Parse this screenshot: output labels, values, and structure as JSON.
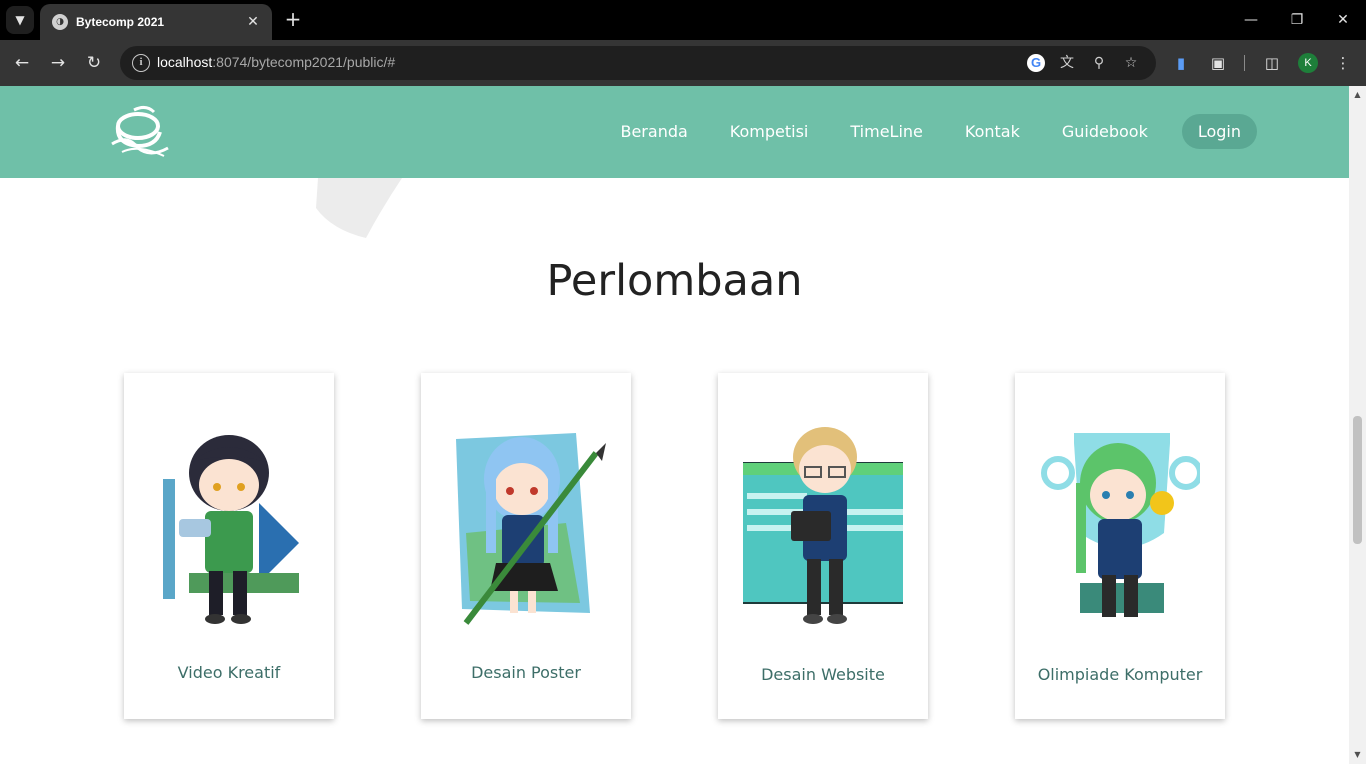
{
  "browser": {
    "tab_title": "Bytecomp 2021",
    "url_host": "localhost",
    "url_rest": ":8074/bytecomp2021/public/#",
    "profile_initial": "K"
  },
  "site": {
    "nav": {
      "links": [
        "Beranda",
        "Kompetisi",
        "TimeLine",
        "Kontak",
        "Guidebook"
      ],
      "login_label": "Login"
    },
    "section_title": "Perlombaan",
    "cards": [
      {
        "label": "Video Kreatif"
      },
      {
        "label": "Desain Poster"
      },
      {
        "label": "Desain Website"
      },
      {
        "label": "Olimpiade Komputer"
      }
    ]
  },
  "colors": {
    "nav_bg": "#6fc0a8",
    "login_bg": "#5aa893",
    "card_label": "#3d6e68"
  }
}
